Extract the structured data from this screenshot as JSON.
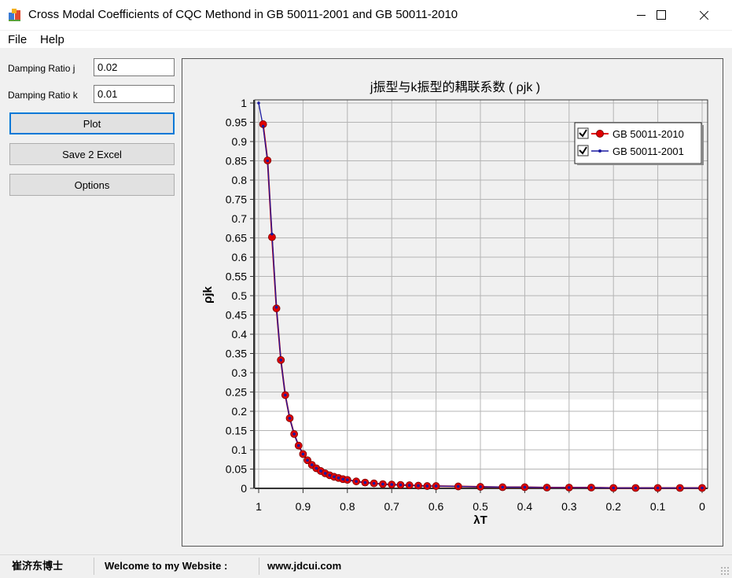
{
  "window": {
    "title": "Cross Modal Coefficients of CQC Methond in GB 50011-2001 and GB 50011-2010",
    "icon": "app-icon"
  },
  "menu": {
    "file": "File",
    "help": "Help"
  },
  "controls": {
    "damping_j_label": "Damping Ratio j",
    "damping_j_value": "0.02",
    "damping_k_label": "Damping Ratio k",
    "damping_k_value": "0.01",
    "plot_label": "Plot",
    "save_label": "Save 2 Excel",
    "options_label": "Options"
  },
  "colors": {
    "series_2010": "#e00000",
    "series_2001": "#1a1aa0",
    "plot_shade": "#f0f0f0",
    "grid": "#b4b4b4",
    "focus": "#0078d7"
  },
  "status": {
    "author": "崔济东博士",
    "welcome": "Welcome to my Website :",
    "website": "www.jdcui.com"
  },
  "chart_data": {
    "type": "line",
    "title": "j振型与k振型的耦联系数 ( ρjk )",
    "xlabel": "λT",
    "ylabel": "ρjk",
    "xlim": [
      1,
      0
    ],
    "x_reversed": true,
    "ylim": [
      0,
      1
    ],
    "x_ticks": [
      "1",
      "0.9",
      "0.8",
      "0.7",
      "0.6",
      "0.5",
      "0.4",
      "0.3",
      "0.2",
      "0.1",
      "0"
    ],
    "y_ticks": [
      "1",
      "0.95",
      "0.9",
      "0.85",
      "0.8",
      "0.75",
      "0.7",
      "0.65",
      "0.6",
      "0.55",
      "0.5",
      "0.45",
      "0.4",
      "0.35",
      "0.3",
      "0.25",
      "0.2",
      "0.15",
      "0.1",
      "0.05",
      "0"
    ],
    "grid": true,
    "legend_position": "top-right",
    "series": [
      {
        "name": "GB 50011-2010",
        "marker": "circle",
        "x": [
          0.99,
          0.98,
          0.97,
          0.96,
          0.95,
          0.94,
          0.93,
          0.92,
          0.91,
          0.9,
          0.89,
          0.88,
          0.87,
          0.86,
          0.85,
          0.84,
          0.83,
          0.82,
          0.81,
          0.8,
          0.78,
          0.76,
          0.74,
          0.72,
          0.7,
          0.68,
          0.66,
          0.64,
          0.62,
          0.6,
          0.55,
          0.5,
          0.45,
          0.4,
          0.35,
          0.3,
          0.25,
          0.2,
          0.15,
          0.1,
          0.05,
          0.0
        ],
        "y": [
          0.945,
          0.851,
          0.652,
          0.467,
          0.333,
          0.242,
          0.182,
          0.141,
          0.111,
          0.089,
          0.073,
          0.061,
          0.052,
          0.045,
          0.039,
          0.034,
          0.03,
          0.027,
          0.024,
          0.022,
          0.018,
          0.015,
          0.013,
          0.011,
          0.01,
          0.009,
          0.008,
          0.007,
          0.006,
          0.006,
          0.005,
          0.004,
          0.003,
          0.003,
          0.002,
          0.002,
          0.002,
          0.001,
          0.001,
          0.001,
          0.001,
          0.001
        ]
      },
      {
        "name": "GB 50011-2001",
        "marker": "dot",
        "x": [
          1.0,
          0.99,
          0.98,
          0.97,
          0.96,
          0.95,
          0.94,
          0.93,
          0.92,
          0.91,
          0.9,
          0.89,
          0.88,
          0.87,
          0.86,
          0.85,
          0.84,
          0.83,
          0.82,
          0.81,
          0.8,
          0.78,
          0.76,
          0.74,
          0.72,
          0.7,
          0.68,
          0.66,
          0.64,
          0.62,
          0.6,
          0.55,
          0.5,
          0.45,
          0.4,
          0.35,
          0.3,
          0.25,
          0.2,
          0.15,
          0.1,
          0.05,
          0.0
        ],
        "y": [
          1.0,
          0.94,
          0.85,
          0.66,
          0.47,
          0.333,
          0.242,
          0.182,
          0.141,
          0.111,
          0.089,
          0.073,
          0.061,
          0.052,
          0.045,
          0.039,
          0.034,
          0.03,
          0.027,
          0.024,
          0.022,
          0.018,
          0.015,
          0.013,
          0.011,
          0.01,
          0.009,
          0.008,
          0.007,
          0.006,
          0.006,
          0.005,
          0.004,
          0.003,
          0.003,
          0.002,
          0.002,
          0.002,
          0.001,
          0.001,
          0.001,
          0.001,
          0.001
        ]
      }
    ]
  }
}
